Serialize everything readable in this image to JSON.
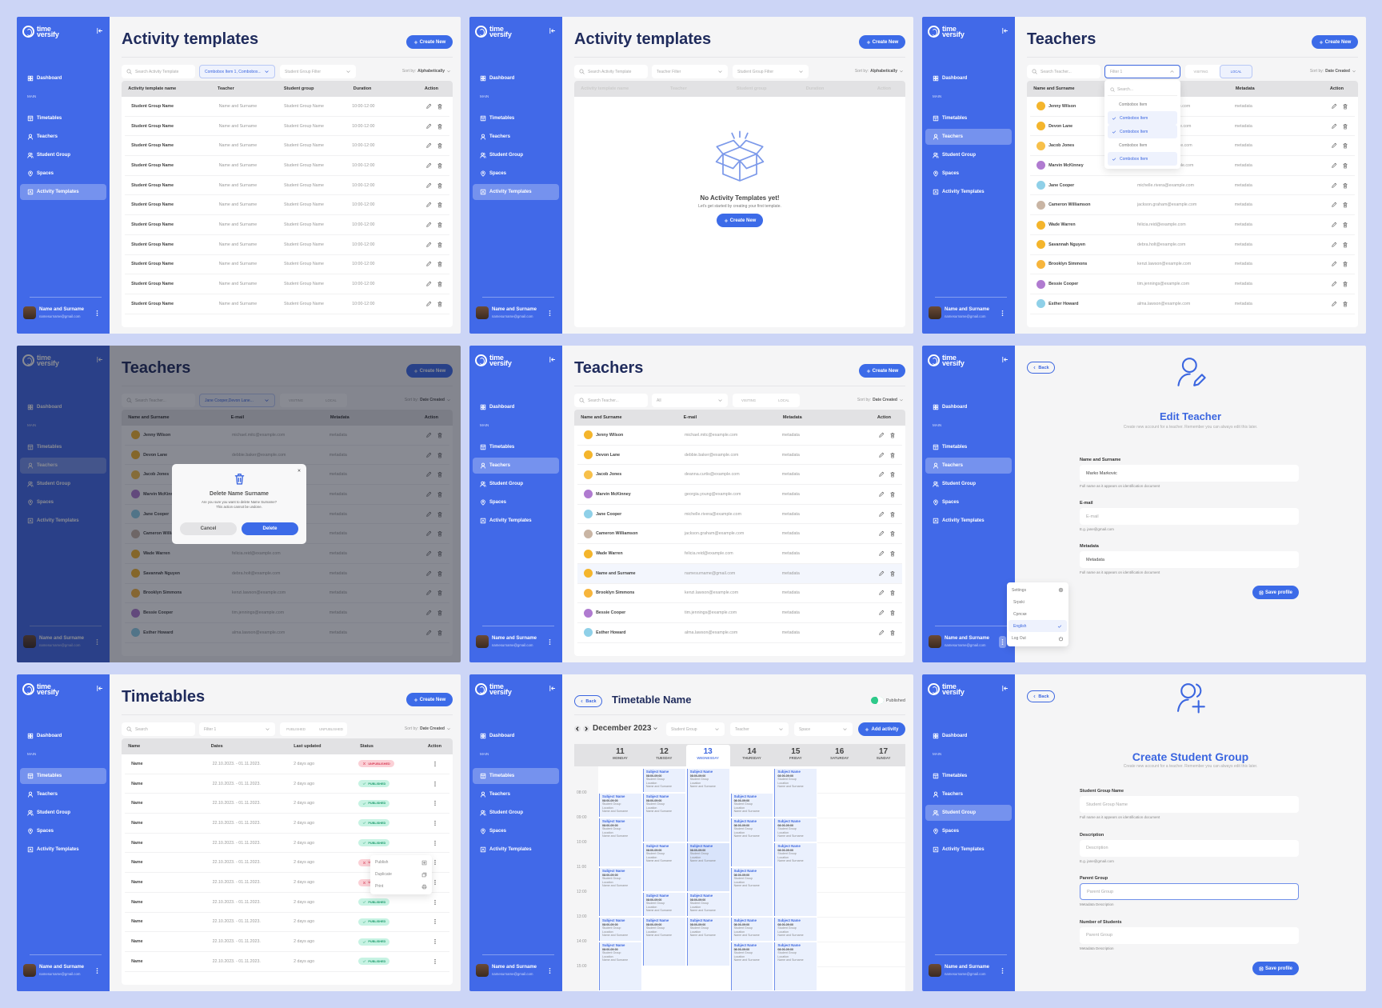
{
  "app": {
    "brand_line1": "time",
    "brand_line2": "versify",
    "colors": {
      "sidebar": "#4169e8",
      "accent": "#3c6be8",
      "title": "#1f2b5c",
      "published": "#1f9d6e",
      "unpublished": "#d83b55",
      "background": "#ccd5f6"
    }
  },
  "sidebar": {
    "dashboard": "Dashboard",
    "section": "MAIN",
    "items": [
      "Timetables",
      "Teachers",
      "Student Group",
      "Spaces",
      "Activity Templates"
    ],
    "user_name": "Name and Surname",
    "user_email": "namesurname@gmail.com"
  },
  "screens": [
    {
      "screen": "activity-templates",
      "kind": "list",
      "active_nav": 4,
      "title": "Activity templates",
      "create_label": "Create New",
      "toolbar": {
        "search": "Search Activity Template",
        "filters": [
          {
            "label": "Combobox Item 1, Combobox...",
            "state": "selected"
          },
          {
            "label": "Student Group Filter",
            "state": "default"
          }
        ],
        "sort_label": "Sort by:",
        "sort_value": "Alphabetically"
      },
      "table": {
        "kind": "activity",
        "headers": [
          "Activity template name",
          "Teacher",
          "Student group",
          "Duration",
          "Action"
        ],
        "action": "edit-delete",
        "rows": [
          [
            "Student Group Name",
            "Name and Surname",
            "Student Group Name",
            "10:00-12:00"
          ],
          [
            "Student Group Name",
            "Name and Surname",
            "Student Group Name",
            "10:00-12:00"
          ],
          [
            "Student Group Name",
            "Name and Surname",
            "Student Group Name",
            "10:00-12:00"
          ],
          [
            "Student Group Name",
            "Name and Surname",
            "Student Group Name",
            "10:00-12:00"
          ],
          [
            "Student Group Name",
            "Name and Surname",
            "Student Group Name",
            "10:00-12:00"
          ],
          [
            "Student Group Name",
            "Name and Surname",
            "Student Group Name",
            "10:00-12:00"
          ],
          [
            "Student Group Name",
            "Name and Surname",
            "Student Group Name",
            "10:00-12:00"
          ],
          [
            "Student Group Name",
            "Name and Surname",
            "Student Group Name",
            "10:00-12:00"
          ],
          [
            "Student Group Name",
            "Name and Surname",
            "Student Group Name",
            "10:00-12:00"
          ],
          [
            "Student Group Name",
            "Name and Surname",
            "Student Group Name",
            "10:00-12:00"
          ],
          [
            "Student Group Name",
            "Name and Surname",
            "Student Group Name",
            "10:00-12:00"
          ]
        ]
      }
    },
    {
      "screen": "activity-templates-empty",
      "kind": "list",
      "active_nav": 4,
      "title": "Activity templates",
      "create_label": "Create New",
      "toolbar": {
        "search": "Search Activity Template",
        "filters": [
          {
            "label": "Teacher Filter",
            "state": "default"
          },
          {
            "label": "Student Group Filter",
            "state": "default"
          }
        ],
        "sort_label": "Sort by:",
        "sort_value": "Alphabetically"
      },
      "table": {
        "kind": "activity",
        "headers": [
          "Activity template name",
          "Teacher",
          "Student group",
          "Duration",
          "Action"
        ],
        "rows": []
      },
      "empty": {
        "title": "No Activity Templates yet!",
        "message": "Let's get started by creating your first template.",
        "button": "Create New"
      }
    },
    {
      "screen": "teachers-filter-open",
      "kind": "list",
      "active_nav": 1,
      "title": "Teachers",
      "create_label": "Create New",
      "toolbar": {
        "search": "Search Teacher...",
        "filters": [
          {
            "label": "Filter 1",
            "state": "open"
          }
        ],
        "segment": {
          "options": [
            "VISITING",
            "LOCAL"
          ],
          "selected": 1
        },
        "sort_label": "Sort by:",
        "sort_value": "Date Created"
      },
      "table": {
        "kind": "teachers",
        "headers": [
          "Name and Surname",
          "E-mail",
          "Metadata",
          "Action"
        ],
        "action": "edit-delete",
        "avatar": true,
        "rows": [
          [
            "Jenny Wilson",
            "michael.mitc@example.com",
            "metadata"
          ],
          [
            "Devon Lane",
            "debbie.baker@example.com",
            "metadata"
          ],
          [
            "Jacob Jones",
            "deanna.curtis@example.com",
            "metadata"
          ],
          [
            "Marvin McKinney",
            "georgia.young@example.com",
            "metadata"
          ],
          [
            "Jane Cooper",
            "michelle.rivera@example.com",
            "metadata"
          ],
          [
            "Cameron Williamson",
            "jackson.graham@example.com",
            "metadata"
          ],
          [
            "Wade Warren",
            "felicia.reid@example.com",
            "metadata"
          ],
          [
            "Savannah Nguyen",
            "debra.holt@example.com",
            "metadata"
          ],
          [
            "Brooklyn Simmons",
            "kenzi.lawson@example.com",
            "metadata"
          ],
          [
            "Bessie Cooper",
            "tim.jennings@example.com",
            "metadata"
          ],
          [
            "Esther Howard",
            "alma.lawson@example.com",
            "metadata"
          ]
        ]
      },
      "dropdown": {
        "search": "Search...",
        "items": [
          {
            "label": "Combobox Item",
            "checked": false
          },
          {
            "label": "Combobox Item",
            "checked": true
          },
          {
            "label": "Combobox Item",
            "checked": true
          },
          {
            "label": "Combobox Item",
            "checked": false
          },
          {
            "label": "Combobox Item",
            "checked": true
          }
        ]
      }
    },
    {
      "screen": "teachers-delete-modal",
      "kind": "list",
      "active_nav": 1,
      "title": "Teachers",
      "create_label": "Create New",
      "toolbar": {
        "search": "Search Teacher...",
        "filters": [
          {
            "label": "Jane Cooper,Devon Lane...",
            "state": "selected"
          }
        ],
        "segment": {
          "options": [
            "VISITING",
            "LOCAL"
          ],
          "selected": null
        },
        "sort_label": "Sort by:",
        "sort_value": "Date Created"
      },
      "table": {
        "kind": "teachers",
        "headers": [
          "Name and Surname",
          "E-mail",
          "Metadata",
          "Action"
        ],
        "action": "edit-delete",
        "avatar": true,
        "rows": [
          [
            "Jenny Wilson",
            "michael.mitc@example.com",
            "metadata"
          ],
          [
            "Devon Lane",
            "debbie.baker@example.com",
            "metadata"
          ],
          [
            "Jacob Jones",
            "deanna.curtis@example.com",
            "metadata"
          ],
          [
            "Marvin McKinney",
            "georgia.young@example.com",
            "metadata"
          ],
          [
            "Jane Cooper",
            "michelle.rivera@example.com",
            "metadata"
          ],
          [
            "Cameron Williamson",
            "jackson.graham@example.com",
            "metadata"
          ],
          [
            "Wade Warren",
            "felicia.reid@example.com",
            "metadata"
          ],
          [
            "Savannah Nguyen",
            "debra.holt@example.com",
            "metadata"
          ],
          [
            "Brooklyn Simmons",
            "kenzi.lawson@example.com",
            "metadata"
          ],
          [
            "Bessie Cooper",
            "tim.jennings@example.com",
            "metadata"
          ],
          [
            "Esther Howard",
            "alma.lawson@example.com",
            "metadata"
          ]
        ]
      },
      "modal": {
        "title": "Delete Name Surname",
        "line1": "Are you sure you want to delete Name Surname?",
        "line2": "This action cannot be undone.",
        "cancel": "Cancel",
        "confirm": "Delete"
      }
    },
    {
      "screen": "teachers",
      "kind": "list",
      "active_nav": 1,
      "title": "Teachers",
      "create_label": "Create New",
      "toolbar": {
        "search": "Search Teacher...",
        "filters": [
          {
            "label": "All",
            "state": "default"
          }
        ],
        "segment": {
          "options": [
            "VISITING",
            "LOCAL"
          ],
          "selected": null
        },
        "sort_label": "Sort by:",
        "sort_value": "Date Created"
      },
      "table": {
        "kind": "teachers",
        "headers": [
          "Name and Surname",
          "E-mail",
          "Metadata",
          "Action"
        ],
        "action": "edit-delete",
        "avatar": true,
        "highlight_row": 7,
        "rows": [
          [
            "Jenny Wilson",
            "michael.mitc@example.com",
            "metadata"
          ],
          [
            "Devon Lane",
            "debbie.baker@example.com",
            "metadata"
          ],
          [
            "Jacob Jones",
            "deanna.curtis@example.com",
            "metadata"
          ],
          [
            "Marvin McKinney",
            "georgia.young@example.com",
            "metadata"
          ],
          [
            "Jane Cooper",
            "michelle.rivera@example.com",
            "metadata"
          ],
          [
            "Cameron Williamson",
            "jackson.graham@example.com",
            "metadata"
          ],
          [
            "Wade Warren",
            "felicia.reid@example.com",
            "metadata"
          ],
          [
            "Name and Surname",
            "namesurname@gmail.com",
            "metadata"
          ],
          [
            "Brooklyn Simmons",
            "kenzi.lawson@example.com",
            "metadata"
          ],
          [
            "Bessie Cooper",
            "tim.jennings@example.com",
            "metadata"
          ],
          [
            "Esther Howard",
            "alma.lawson@example.com",
            "metadata"
          ]
        ]
      }
    },
    {
      "screen": "edit-teacher",
      "kind": "form",
      "active_nav": 1,
      "back": "Back",
      "icon": "user-edit-icon",
      "title": "Edit Teacher",
      "subtitle": "Create new account for a teacher. Remember you can always edit this later.",
      "fields": [
        {
          "label": "Name and Surname",
          "value": "Marko Markovic",
          "help": "Full name as it appears on identification document"
        },
        {
          "label": "E-mail",
          "placeholder": "E-mail",
          "help": "E.g. jane@gmail.com"
        },
        {
          "label": "Metadata",
          "value": "Metadata",
          "help": "Full name as it appears on identification document"
        }
      ],
      "save": "Save profile",
      "menu": {
        "settings": "Settings",
        "languages": [
          "Srpski",
          "Српски",
          "English"
        ],
        "selected_language": "English",
        "logout": "Log Out"
      }
    },
    {
      "screen": "timetables",
      "kind": "list",
      "active_nav": 0,
      "title": "Timetables",
      "create_label": "Create New",
      "toolbar": {
        "search": "Search",
        "filters": [
          {
            "label": "Filter 1",
            "state": "default"
          }
        ],
        "segment": {
          "options": [
            "PUBLISHED",
            "UNPUBLISHED"
          ],
          "selected": null
        },
        "sort_label": "Sort by:",
        "sort_value": "Date Created"
      },
      "table": {
        "kind": "timetables",
        "headers": [
          "Name",
          "Dates",
          "Last updated",
          "Status",
          "Action"
        ],
        "action": "kebab",
        "status_col": 3,
        "rows": [
          [
            "Name",
            "22.10.2023. - 01.11.2023.",
            "2 days ago",
            "UNPUBLISHED"
          ],
          [
            "Name",
            "22.10.2023. - 01.11.2023.",
            "2 days ago",
            "PUBLISHED"
          ],
          [
            "Name",
            "22.10.2023. - 01.11.2023.",
            "2 days ago",
            "PUBLISHED"
          ],
          [
            "Name",
            "22.10.2023. - 01.11.2023.",
            "2 days ago",
            "PUBLISHED"
          ],
          [
            "Name",
            "22.10.2023. - 01.11.2023.",
            "2 days ago",
            "PUBLISHED"
          ],
          [
            "Name",
            "22.10.2023. - 01.11.2023.",
            "2 days ago",
            "UNPUBLISHED"
          ],
          [
            "Name",
            "22.10.2023. - 01.11.2023.",
            "2 days ago",
            "UNPUBLISHED"
          ],
          [
            "Name",
            "22.10.2023. - 01.11.2023.",
            "2 days ago",
            "PUBLISHED"
          ],
          [
            "Name",
            "22.10.2023. - 01.11.2023.",
            "2 days ago",
            "PUBLISHED"
          ],
          [
            "Name",
            "22.10.2023. - 01.11.2023.",
            "2 days ago",
            "PUBLISHED"
          ],
          [
            "Name",
            "22.10.2023. - 01.11.2023.",
            "2 days ago",
            "PUBLISHED"
          ]
        ]
      },
      "context_menu": {
        "row": 5,
        "items": [
          "Publish",
          "Duplicate",
          "Print"
        ]
      }
    },
    {
      "screen": "timetable-calendar",
      "kind": "calendar",
      "active_nav": 0,
      "back": "Back",
      "title": "Timetable Name",
      "published": true,
      "published_label": "Published",
      "month": "December 2023",
      "selects": [
        "Student Group",
        "Teacher",
        "Space"
      ],
      "add_label": "Add activity",
      "days": [
        {
          "num": "11",
          "name": "MONDAY"
        },
        {
          "num": "12",
          "name": "TUESDAY"
        },
        {
          "num": "13",
          "name": "WEDNESDAY"
        },
        {
          "num": "14",
          "name": "THURSDAY"
        },
        {
          "num": "15",
          "name": "FRIDAY"
        },
        {
          "num": "16",
          "name": "SATURDAY"
        },
        {
          "num": "17",
          "name": "SUNDAY"
        }
      ],
      "today_index": 2,
      "hours": [
        "08:00",
        "09:00",
        "10:00",
        "11:00",
        "12:00",
        "13:00",
        "14:00",
        "15:00"
      ],
      "event_text": {
        "subject": "Subject Name",
        "time": "08:00-09:00",
        "group": "Student Group",
        "location": "Location",
        "teacher": "Name and Surname"
      },
      "events": [
        {
          "day": 0,
          "start": 8,
          "end": 9
        },
        {
          "day": 0,
          "start": 9,
          "end": 11
        },
        {
          "day": 0,
          "start": 11,
          "end": 13
        },
        {
          "day": 0,
          "start": 13,
          "end": 14
        },
        {
          "day": 0,
          "start": 14,
          "end": 16
        },
        {
          "day": 1,
          "start": 7,
          "end": 8
        },
        {
          "day": 1,
          "start": 8,
          "end": 10
        },
        {
          "day": 1,
          "start": 10,
          "end": 12
        },
        {
          "day": 1,
          "start": 12,
          "end": 13
        },
        {
          "day": 1,
          "start": 13,
          "end": 15
        },
        {
          "day": 2,
          "start": 7,
          "end": 10
        },
        {
          "day": 2,
          "start": 10,
          "end": 12,
          "selected": true
        },
        {
          "day": 2,
          "start": 12,
          "end": 13
        },
        {
          "day": 2,
          "start": 13,
          "end": 15
        },
        {
          "day": 3,
          "start": 8,
          "end": 9
        },
        {
          "day": 3,
          "start": 9,
          "end": 11
        },
        {
          "day": 3,
          "start": 11,
          "end": 13
        },
        {
          "day": 3,
          "start": 13,
          "end": 14
        },
        {
          "day": 3,
          "start": 14,
          "end": 16
        },
        {
          "day": 4,
          "start": 7,
          "end": 9
        },
        {
          "day": 4,
          "start": 9,
          "end": 10
        },
        {
          "day": 4,
          "start": 10,
          "end": 13
        },
        {
          "day": 4,
          "start": 13,
          "end": 14
        },
        {
          "day": 4,
          "start": 14,
          "end": 16
        }
      ]
    },
    {
      "screen": "create-student-group",
      "kind": "form",
      "active_nav": 2,
      "back": "Back",
      "icon": "users-plus-icon",
      "title": "Create Student Group",
      "subtitle": "Create new account for a teacher. Remember you can always edit this later.",
      "fields": [
        {
          "label": "Student Group Name",
          "placeholder": "Student Group Name",
          "help": "Full name as it appears on identification document"
        },
        {
          "label": "Description",
          "placeholder": "Description",
          "help": "E.g. jane@gmail.com"
        },
        {
          "label": "Parent Group",
          "placeholder": "Parent Group",
          "help": "Metadata Description",
          "focused": true
        },
        {
          "label": "Number of Students",
          "placeholder": "Parent Group",
          "help": "Metadata Description"
        }
      ],
      "save": "Save profile"
    }
  ]
}
